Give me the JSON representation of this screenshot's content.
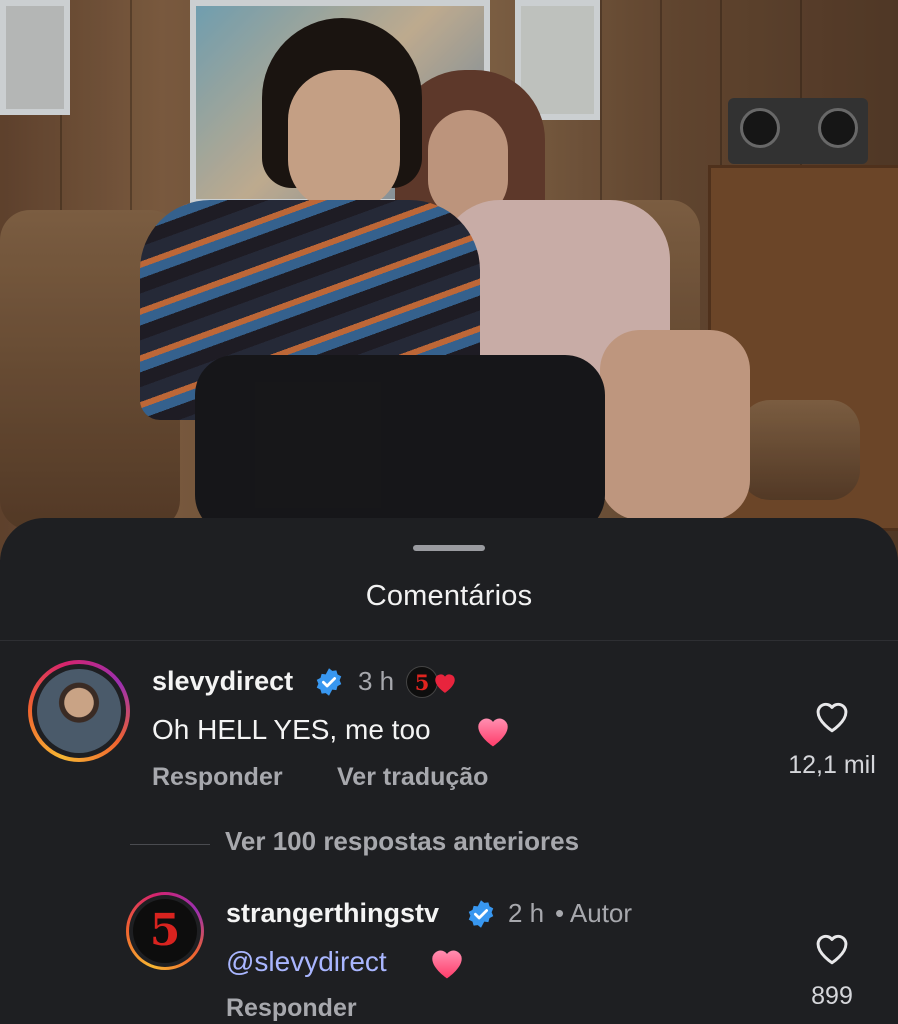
{
  "sheet": {
    "title": "Comentários"
  },
  "comments": [
    {
      "username": "slevydirect",
      "verified": true,
      "time": "3 h",
      "creator_badge": "5",
      "text": "Oh HELL YES, me too",
      "text_emoji": "heart-emoji",
      "actions": {
        "reply": "Responder",
        "translate": "Ver tradução"
      },
      "likes": "12,1 mil"
    }
  ],
  "replies_toggle": "Ver 100 respostas anteriores",
  "reply": {
    "username": "strangerthingstv",
    "verified": true,
    "time": "2 h",
    "author_label": "• Autor",
    "avatar_glyph": "5",
    "mention": "@slevydirect",
    "text_emoji": "heart-emoji",
    "actions": {
      "reply": "Responder"
    },
    "likes": "899"
  },
  "colors": {
    "background": "#1e1f22",
    "verified_blue": "#3897f0",
    "mention": "#a9b6ff",
    "heart": "#ff4f79",
    "muted_text": "#a7a8ad"
  }
}
